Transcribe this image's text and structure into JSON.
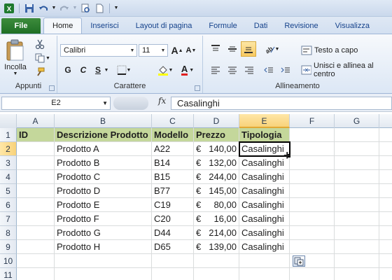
{
  "ribbon_tabs": [
    "File",
    "Home",
    "Inserisci",
    "Layout di pagina",
    "Formule",
    "Dati",
    "Revisione",
    "Visualizza"
  ],
  "active_tab": "Home",
  "clipboard": {
    "paste_label": "Incolla",
    "group_label": "Appunti"
  },
  "font": {
    "name": "Calibri",
    "size": "11",
    "bold": "G",
    "italic": "C",
    "underline": "S",
    "group_label": "Carattere"
  },
  "alignment": {
    "wrap_text": "Testo a capo",
    "merge_center": "Unisci e allinea al centro",
    "group_label": "Allineamento"
  },
  "formula_bar": {
    "name_box": "E2",
    "fx": "fx",
    "content": "Casalinghi"
  },
  "columns": [
    "A",
    "B",
    "C",
    "D",
    "E",
    "F",
    "G"
  ],
  "selected_column": "E",
  "selected_row": "2",
  "rows": [
    "1",
    "2",
    "3",
    "4",
    "5",
    "6",
    "7",
    "8",
    "9",
    "10",
    "11"
  ],
  "headers": [
    "ID",
    "Descrizione Prodotto",
    "Modello",
    "Prezzo",
    "Tipologia"
  ],
  "table_rows": [
    {
      "desc": "Prodotto A",
      "model": "A22",
      "currency": "€",
      "price": "140,00",
      "type": "Casalinghi"
    },
    {
      "desc": "Prodotto B",
      "model": "B14",
      "currency": "€",
      "price": "132,00",
      "type": "Casalinghi"
    },
    {
      "desc": "Prodotto C",
      "model": "B15",
      "currency": "€",
      "price": "244,00",
      "type": "Casalinghi"
    },
    {
      "desc": "Prodotto D",
      "model": "B77",
      "currency": "€",
      "price": "145,00",
      "type": "Casalinghi"
    },
    {
      "desc": "Prodotto E",
      "model": "C19",
      "currency": "€",
      "price": "80,00",
      "type": "Casalinghi"
    },
    {
      "desc": "Prodotto F",
      "model": "C20",
      "currency": "€",
      "price": "16,00",
      "type": "Casalinghi"
    },
    {
      "desc": "Prodotto G",
      "model": "D44",
      "currency": "€",
      "price": "214,00",
      "type": "Casalinghi"
    },
    {
      "desc": "Prodotto H",
      "model": "D65",
      "currency": "€",
      "price": "139,00",
      "type": "Casalinghi"
    }
  ],
  "colors": {
    "header_fill": "#c4d79b",
    "file_tab": "#2a7a2f",
    "selection_highlight": "#f8d27a"
  }
}
